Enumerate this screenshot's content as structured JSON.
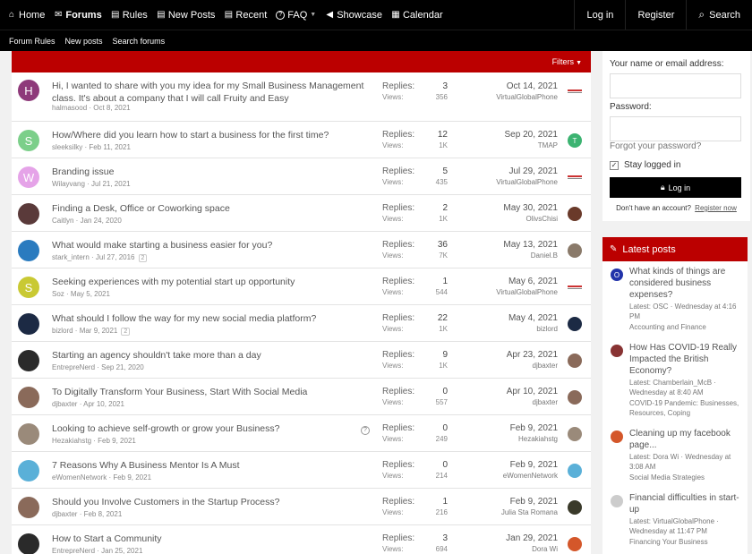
{
  "nav": {
    "items": [
      {
        "label": "Home",
        "icon": "home-icon",
        "glyph": "⌂"
      },
      {
        "label": "",
        "icon": "chat-icon",
        "glyph": "💬"
      },
      {
        "label": "Forums",
        "icon": "forums-icon",
        "glyph": ""
      },
      {
        "label": "Rules",
        "icon": "document-icon",
        "glyph": "▤"
      },
      {
        "label": "New Posts",
        "icon": "document-icon",
        "glyph": "▤"
      },
      {
        "label": "Recent",
        "icon": "document-icon",
        "glyph": "▤"
      },
      {
        "label": "FAQ",
        "icon": "help-icon",
        "glyph": "?"
      },
      {
        "label": "Showcase",
        "icon": "megaphone-icon",
        "glyph": "📢"
      },
      {
        "label": "Calendar",
        "icon": "calendar-icon",
        "glyph": "▦"
      }
    ],
    "login": "Log in",
    "register": "Register",
    "search": "Search"
  },
  "subnav": [
    "Forum Rules",
    "New posts",
    "Search forums"
  ],
  "filters_label": "Filters",
  "stat_labels": {
    "replies": "Replies:",
    "views": "Views:"
  },
  "threads": [
    {
      "title": "Hi, I wanted to share with you my idea for my Small Business Management class. It's about a company that I will call Fruity and Easy",
      "author": "halmasood",
      "date": "Oct 8, 2021",
      "replies": "3",
      "views": "356",
      "last_date": "Oct 14, 2021",
      "last_user": "VirtualGlobalPhone",
      "avatar_letter": "H",
      "avatar_color": "#8e3a7a"
    },
    {
      "title": "How/Where did you learn how to start a business for the first time?",
      "author": "sleeksilky",
      "date": "Feb 11, 2021",
      "replies": "12",
      "views": "1K",
      "last_date": "Sep 20, 2021",
      "last_user": "TMAP",
      "avatar_letter": "S",
      "avatar_color": "#7ccf8a"
    },
    {
      "title": "Branding issue",
      "author": "Wilayvang",
      "date": "Jul 21, 2021",
      "replies": "5",
      "views": "435",
      "last_date": "Jul 29, 2021",
      "last_user": "VirtualGlobalPhone",
      "avatar_letter": "W",
      "avatar_color": "#e5a3e8"
    },
    {
      "title": "Finding a Desk, Office or Coworking space",
      "author": "Caitlyn",
      "date": "Jan 24, 2020",
      "replies": "2",
      "views": "1K",
      "last_date": "May 30, 2021",
      "last_user": "OlivsChisi",
      "avatar_letter": "",
      "avatar_color": "#5a3a3a"
    },
    {
      "title": "What would make starting a business easier for you?",
      "author": "stark_intern",
      "date": "Jul 27, 2016",
      "pages": "2",
      "replies": "36",
      "views": "7K",
      "last_date": "May 13, 2021",
      "last_user": "Daniel.B",
      "avatar_letter": "",
      "avatar_color": "#2a7bbf"
    },
    {
      "title": "Seeking experiences with my potential start up opportunity",
      "author": "Soz",
      "date": "May 5, 2021",
      "replies": "1",
      "views": "544",
      "last_date": "May 6, 2021",
      "last_user": "VirtualGlobalPhone",
      "avatar_letter": "S",
      "avatar_color": "#c9c933"
    },
    {
      "title": "What should I follow the way for my new social media platform?",
      "author": "bizlord",
      "date": "Mar 9, 2021",
      "pages": "2",
      "replies": "22",
      "views": "1K",
      "last_date": "May 4, 2021",
      "last_user": "bizlord",
      "avatar_letter": "",
      "avatar_color": "#1c2a44"
    },
    {
      "title": "Starting an agency shouldn't take more than a day",
      "author": "EntrepreNerd",
      "date": "Sep 21, 2020",
      "replies": "9",
      "views": "1K",
      "last_date": "Apr 23, 2021",
      "last_user": "djbaxter",
      "avatar_letter": "",
      "avatar_color": "#2a2a2a"
    },
    {
      "title": "To Digitally Transform Your Business, Start With Social Media",
      "author": "djbaxter",
      "date": "Apr 10, 2021",
      "replies": "0",
      "views": "557",
      "last_date": "Apr 10, 2021",
      "last_user": "djbaxter",
      "avatar_letter": "",
      "avatar_color": "#8a6a5a"
    },
    {
      "title": "Looking to achieve self-growth or grow your Business?",
      "author": "Hezakiahstg",
      "date": "Feb 9, 2021",
      "replies": "0",
      "views": "249",
      "last_date": "Feb 9, 2021",
      "last_user": "Hezakiahstg",
      "avatar_letter": "",
      "avatar_color": "#9a8a7a",
      "help": "?"
    },
    {
      "title": "7 Reasons Why A Business Mentor Is A Must",
      "author": "eWomenNetwork",
      "date": "Feb 9, 2021",
      "replies": "0",
      "views": "214",
      "last_date": "Feb 9, 2021",
      "last_user": "eWomenNetwork",
      "avatar_letter": "",
      "avatar_color": "#5ab0d8"
    },
    {
      "title": "Should you Involve Customers in the Startup Process?",
      "author": "djbaxter",
      "date": "Feb 8, 2021",
      "replies": "1",
      "views": "216",
      "last_date": "Feb 9, 2021",
      "last_user": "Julia Sta Romana",
      "avatar_letter": "",
      "avatar_color": "#8a6a5a"
    },
    {
      "title": "How to Start a Community",
      "author": "EntrepreNerd",
      "date": "Jan 25, 2021",
      "replies": "3",
      "views": "694",
      "last_date": "Jan 29, 2021",
      "last_user": "Dora Wi",
      "avatar_letter": "",
      "avatar_color": "#2a2a2a"
    }
  ],
  "login_box": {
    "name_label": "Your name or email address:",
    "password_label": "Password:",
    "forgot": "Forgot your password?",
    "stay": "Stay logged in",
    "button": "Log in",
    "no_account": "Don't have an account?",
    "register": "Register now"
  },
  "latest_posts": {
    "heading": "Latest posts",
    "items": [
      {
        "title": "What kinds of things are considered business expenses?",
        "meta": "Latest: OSC · Wednesday at 4:16 PM",
        "forum": "Accounting and Finance",
        "avatar_color": "#2233aa",
        "avatar_letter": "O"
      },
      {
        "title": "How Has COVID-19 Really Impacted the British Economy?",
        "meta": "Latest: Chamberlain_McB · Wednesday at 8:40 AM",
        "forum": "COVID-19 Pandemic: Businesses, Resources, Coping",
        "avatar_color": "#883333",
        "avatar_letter": ""
      },
      {
        "title": "Cleaning up my facebook page...",
        "meta": "Latest: Dora Wi · Wednesday at 3:08 AM",
        "forum": "Social Media Strategies",
        "avatar_color": "#d4572a",
        "avatar_letter": ""
      },
      {
        "title": "Financial difficulties in start-up",
        "meta": "Latest: VirtualGlobalPhone · Wednesday at 11:47 PM",
        "forum": "Financing Your Business",
        "avatar_color": "#cccccc",
        "avatar_letter": ""
      }
    ]
  }
}
